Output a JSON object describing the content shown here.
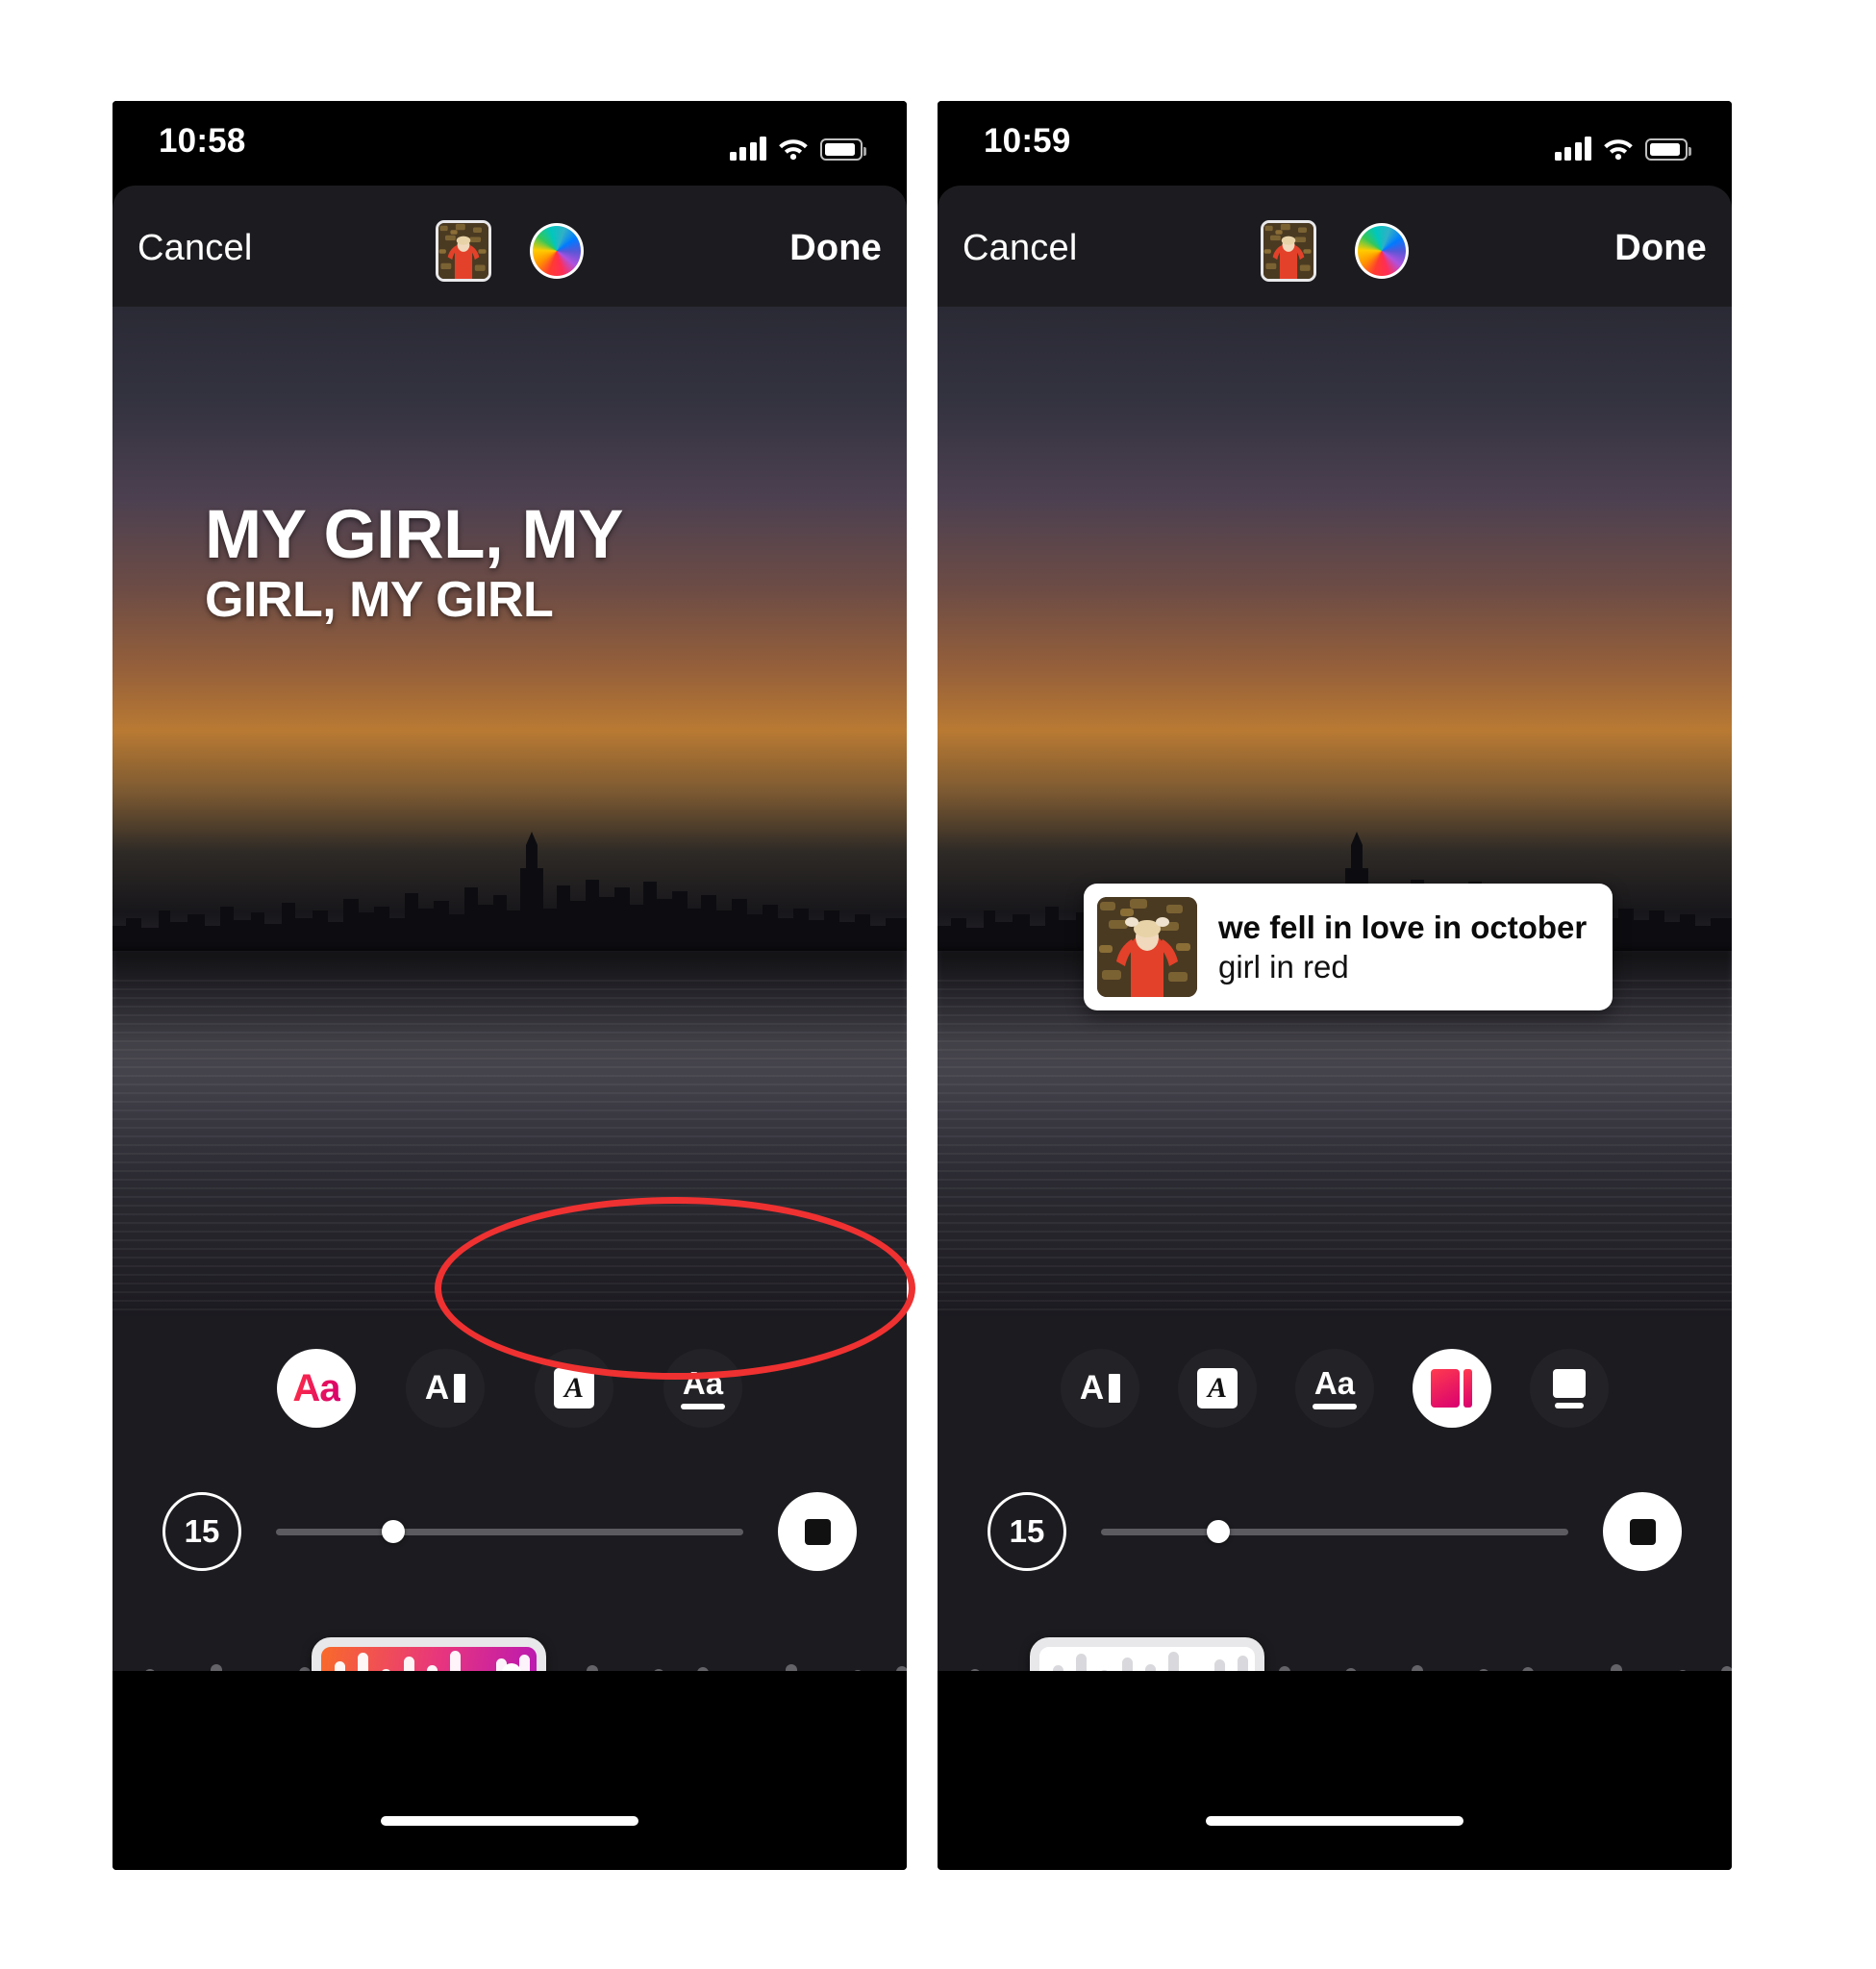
{
  "screens": [
    {
      "id": "left",
      "status": {
        "time": "10:58",
        "signal_icon": "cellular-signal-icon",
        "wifi_icon": "wifi-icon",
        "battery_icon": "battery-icon"
      },
      "toolbar": {
        "cancel_label": "Cancel",
        "done_label": "Done",
        "album_art_name": "album-art-thumbnail",
        "color_wheel_name": "color-picker-wheel"
      },
      "overlay": {
        "type": "lyrics",
        "line1": "MY GIRL, MY",
        "line2": "GIRL, MY GIRL"
      },
      "style_buttons": [
        {
          "id": "style-aa-bold",
          "glyph": "Aa",
          "variant": "gradient-aa",
          "selected": true
        },
        {
          "id": "style-a-bar",
          "glyph": "A",
          "variant": "a-bar",
          "selected": false
        },
        {
          "id": "style-a-boxed",
          "glyph": "A",
          "variant": "boxed-a",
          "selected": false
        },
        {
          "id": "style-aa-underline",
          "glyph": "Aa",
          "variant": "underline-aa",
          "selected": false
        }
      ],
      "duration": {
        "value": "15",
        "unit_hint": "seconds"
      },
      "slider": {
        "position_percent": 25
      },
      "stop_button_name": "stop-button",
      "waveform": {
        "selection_style": "gradient",
        "selection_left_percent": 25
      }
    },
    {
      "id": "right",
      "status": {
        "time": "10:59",
        "signal_icon": "cellular-signal-icon",
        "wifi_icon": "wifi-icon",
        "battery_icon": "battery-icon"
      },
      "toolbar": {
        "cancel_label": "Cancel",
        "done_label": "Done",
        "album_art_name": "album-art-thumbnail",
        "color_wheel_name": "color-picker-wheel"
      },
      "overlay": {
        "type": "sticker-card",
        "track_title": "we fell in love in october",
        "artist": "girl in red"
      },
      "style_buttons": [
        {
          "id": "style-a-bar",
          "glyph": "A",
          "variant": "a-bar",
          "selected": false
        },
        {
          "id": "style-a-boxed",
          "glyph": "A",
          "variant": "boxed-a",
          "selected": false
        },
        {
          "id": "style-aa-underline",
          "glyph": "Aa",
          "variant": "underline-aa",
          "selected": false
        },
        {
          "id": "style-card-color",
          "glyph": "",
          "variant": "card-red",
          "selected": true
        },
        {
          "id": "style-card-plain",
          "glyph": "",
          "variant": "card-white",
          "selected": false
        }
      ],
      "duration": {
        "value": "15",
        "unit_hint": "seconds"
      },
      "slider": {
        "position_percent": 25
      },
      "stop_button_name": "stop-button",
      "waveform": {
        "selection_style": "plain-white",
        "selection_left_percent": 12
      }
    }
  ],
  "annotation": {
    "shape": "ellipse",
    "color": "#ef3131",
    "target": "style-buttons-row"
  },
  "colors": {
    "sheet_bg": "#1c1c20",
    "button_bg": "#232327",
    "accent_pink": "#d6006e",
    "accent_red": "#ff2f45",
    "annotation_red": "#ef3131"
  }
}
